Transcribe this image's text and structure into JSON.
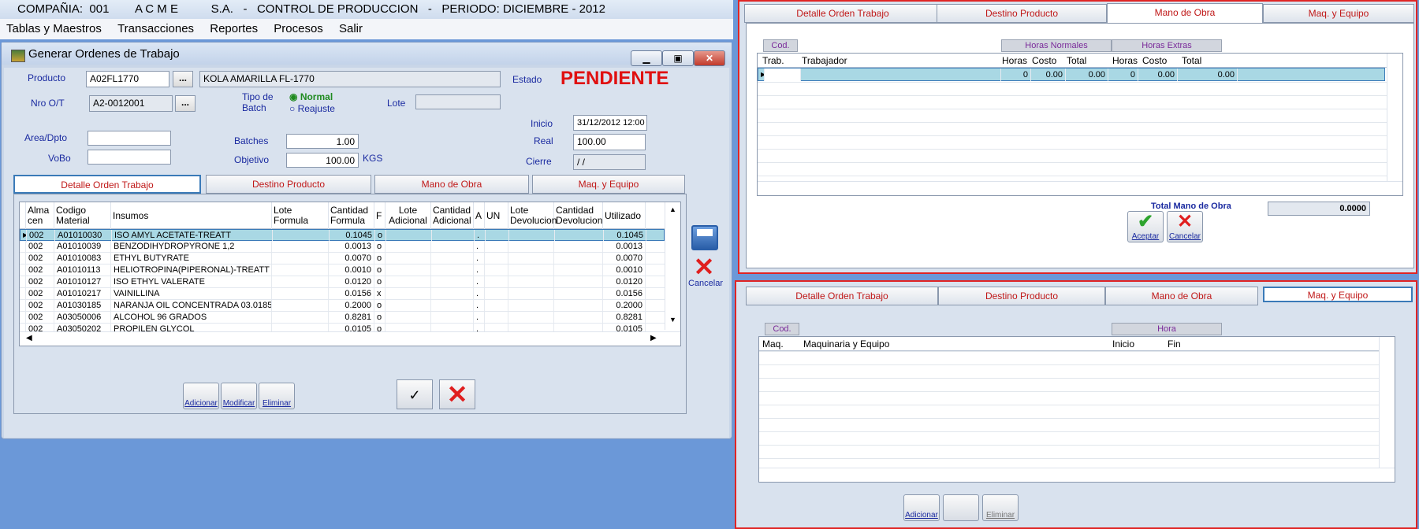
{
  "app": {
    "title_line": "COMPAÑIA:  001        A C M E          S.A.   -   CONTROL DE PRODUCCION   -   PERIODO: DICIEMBRE - 2012",
    "menu": [
      "Tablas y Maestros",
      "Transacciones",
      "Reportes",
      "Procesos",
      "Salir"
    ]
  },
  "window": {
    "title": "Generar Ordenes de Trabajo",
    "min_icon": "minimize-icon",
    "max_icon": "maximize-icon",
    "close_icon": "close-icon"
  },
  "form": {
    "producto_label": "Producto",
    "producto_code": "A02FL1770",
    "producto_desc": "KOLA AMARILLA FL-1770",
    "ellipsis": "...",
    "estado_label": "Estado",
    "estado_value": "PENDIENTE",
    "ot_label": "Nro O/T",
    "ot_value": "A2-0012001",
    "tipo_batch_label1": "Tipo de",
    "tipo_batch_label2": "Batch",
    "radio_normal": "Normal",
    "radio_reajuste": "Reajuste",
    "lote_label": "Lote",
    "lote_value": "",
    "inicio_label": "Inicio",
    "inicio_value": "31/12/2012 12:00",
    "area_label": "Area/Dpto",
    "area_value": "",
    "batches_label": "Batches",
    "batches_value": "1.00",
    "real_label": "Real",
    "real_value": "100.00",
    "vobo_label": "VoBo",
    "vobo_value": "",
    "objetivo_label": "Objetivo",
    "objetivo_value": "100.00",
    "objetivo_unit": "KGS",
    "cierre_label": "Cierre",
    "cierre_value": " /  /"
  },
  "tabs": [
    "Detalle Orden Trabajo",
    "Destino Producto",
    "Mano de Obra",
    "Maq. y Equipo"
  ],
  "detalle": {
    "headers": [
      "Alma\ncen",
      "Codigo\nMaterial",
      "Insumos",
      "Lote\nFormula",
      "Cantidad\nFormula",
      "F",
      "Lote\nAdicional",
      "Cantidad\nAdicional",
      "A",
      "UN",
      "Lote\nDevolucion",
      "Cantidad\nDevolucion",
      "Utilizado"
    ],
    "rows": [
      [
        "002",
        "A01010030",
        "ISO AMYL ACETATE-TREATT",
        "",
        "0.1045",
        "o",
        "",
        "",
        ".",
        "",
        "",
        "",
        "0.1045"
      ],
      [
        "002",
        "A01010039",
        "BENZODIHYDROPYRONE 1,2",
        "",
        "0.0013",
        "o",
        "",
        "",
        ".",
        "",
        "",
        "",
        "0.0013"
      ],
      [
        "002",
        "A01010083",
        "ETHYL BUTYRATE",
        "",
        "0.0070",
        "o",
        "",
        "",
        ".",
        "",
        "",
        "",
        "0.0070"
      ],
      [
        "002",
        "A01010113",
        "HELIOTROPINA(PIPERONAL)-TREATT",
        "",
        "0.0010",
        "o",
        "",
        "",
        ".",
        "",
        "",
        "",
        "0.0010"
      ],
      [
        "002",
        "A01010127",
        "ISO ETHYL VALERATE",
        "",
        "0.0120",
        "o",
        "",
        "",
        ".",
        "",
        "",
        "",
        "0.0120"
      ],
      [
        "002",
        "A01010217",
        "VAINILLINA",
        "",
        "0.0156",
        "x",
        "",
        "",
        ".",
        "",
        "",
        "",
        "0.0156"
      ],
      [
        "002",
        "A01030185",
        "NARANJA OIL CONCENTRADA 03.0185",
        "",
        "0.2000",
        "o",
        "",
        "",
        ".",
        "",
        "",
        "",
        "0.2000"
      ],
      [
        "002",
        "A03050006",
        "ALCOHOL  96  GRADOS",
        "",
        "0.8281",
        "o",
        "",
        "",
        ".",
        "",
        "",
        "",
        "0.8281"
      ],
      [
        "002",
        "A03050202",
        "PROPILEN GLYCOL",
        "",
        "0.0105",
        "o",
        "",
        "",
        ".",
        "",
        "",
        "",
        "0.0105"
      ]
    ],
    "btn_adicionar": "Adicionar",
    "btn_modificar": "Modificar",
    "btn_eliminar": "Eliminar",
    "check_glyph": "✓",
    "save_icon": "save-icon",
    "cancelar": "Cancelar"
  },
  "mano_obra": {
    "cod_label": "Cod.",
    "horas_normales": "Horas Normales",
    "horas_extras": "Horas Extras",
    "headers": [
      "Trab.",
      "Trabajador",
      "Horas",
      "Costo",
      "Total",
      "Horas",
      "Costo",
      "Total"
    ],
    "row": [
      "",
      "",
      "0",
      "0.00",
      "0.00",
      "0",
      "0.00",
      "0.00"
    ],
    "total_label": "Total Mano de Obra",
    "total_value": "0.0000",
    "aceptar": "Aceptar",
    "cancelar": "Cancelar"
  },
  "maq_equipo": {
    "cod_label": "Cod.",
    "hora_label": "Hora",
    "headers": [
      "Maq.",
      "Maquinaria y Equipo",
      "Inicio",
      "Fin"
    ],
    "adicionar": "Adicionar",
    "eliminar": "Eliminar"
  },
  "colors": {
    "tab_text": "#c01818",
    "estado": "#e01010",
    "panel_border": "#e02424",
    "selected_row": "#a9d8e4",
    "desktop": "#6b98d8"
  }
}
